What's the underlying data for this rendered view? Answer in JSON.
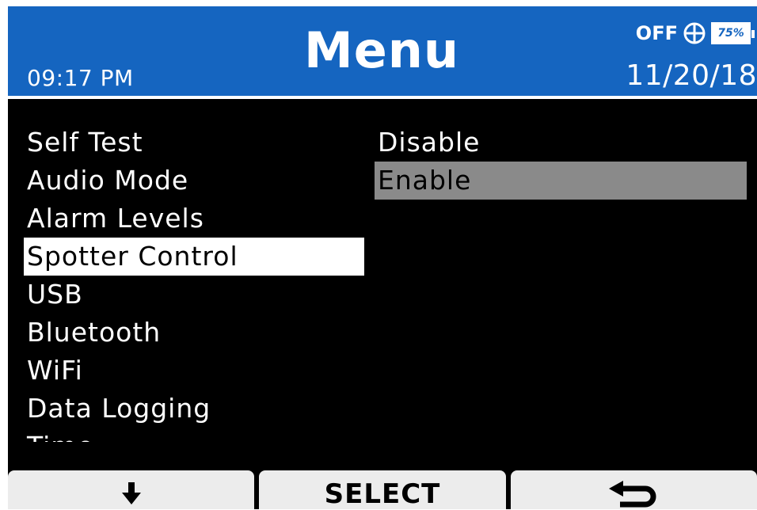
{
  "header": {
    "time": "09:17 PM",
    "title": "Menu",
    "date": "11/20/18",
    "status": {
      "gps_state": "OFF",
      "gps_icon": "crosshair-icon",
      "battery_label": "75%",
      "battery_level": 0.75
    },
    "colors": {
      "bar": "#1565c0",
      "text": "#ffffff"
    }
  },
  "menu": {
    "items": [
      {
        "label": "Self Test"
      },
      {
        "label": "Audio Mode"
      },
      {
        "label": "Alarm Levels"
      },
      {
        "label": "Spotter Control",
        "selected": true
      },
      {
        "label": "USB"
      },
      {
        "label": "Bluetooth"
      },
      {
        "label": "WiFi"
      },
      {
        "label": "Data Logging"
      },
      {
        "label": "Time"
      }
    ]
  },
  "options": {
    "items": [
      {
        "label": "Disable"
      },
      {
        "label": "Enable",
        "highlighted": true
      }
    ]
  },
  "softkeys": {
    "left_icon": "arrow-down-icon",
    "center_label": "SELECT",
    "right_icon": "back-arrow-icon"
  }
}
